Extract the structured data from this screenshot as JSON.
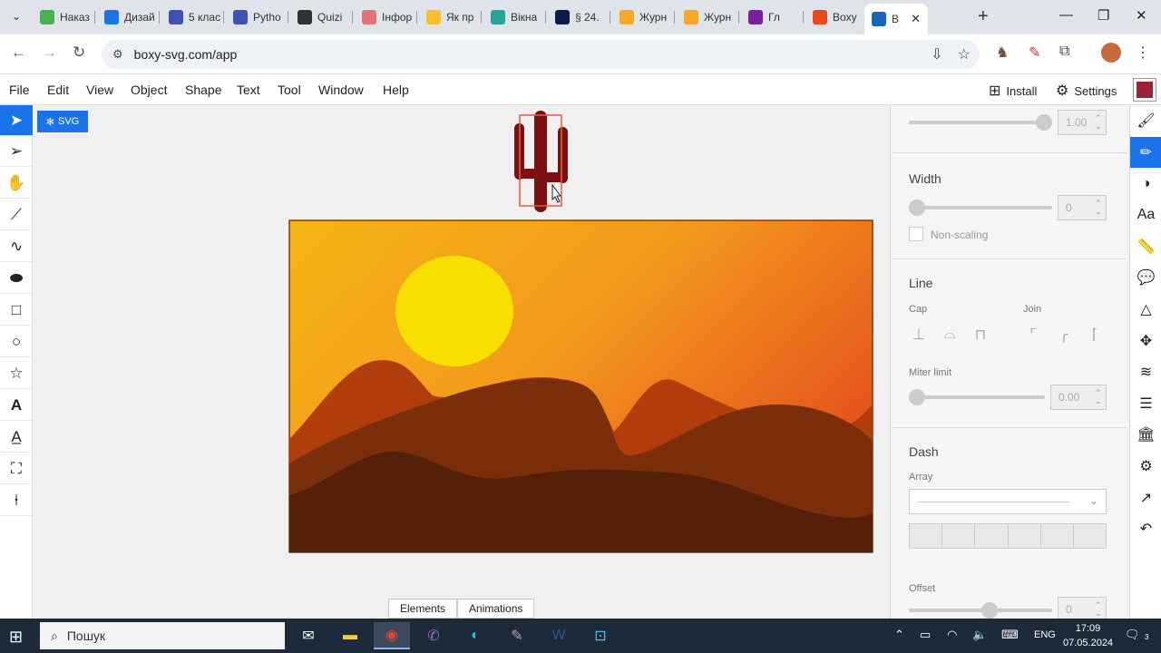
{
  "browser": {
    "tabs": [
      {
        "title": "Наказ",
        "color": "#4caf50"
      },
      {
        "title": "Дизай",
        "color": "#1a73e8"
      },
      {
        "title": "5 клас",
        "color": "#3f51b5"
      },
      {
        "title": "Pytho",
        "color": "#3f51b5"
      },
      {
        "title": "Quizi",
        "color": "#333333"
      },
      {
        "title": "Інфор",
        "color": "#e57373"
      },
      {
        "title": "Як пр",
        "color": "#fbc02d"
      },
      {
        "title": "Вікна",
        "color": "#26a69a"
      },
      {
        "title": "§ 24.",
        "color": "#0d1b4c"
      },
      {
        "title": "Журн",
        "color": "#f9a825"
      },
      {
        "title": "Журн",
        "color": "#f9a825"
      },
      {
        "title": "Гл",
        "color": "#7b1fa2"
      },
      {
        "title": "Boxy",
        "color": "#e64a19"
      },
      {
        "title": "B",
        "color": "#1565c0"
      }
    ],
    "url": "boxy-svg.com/app"
  },
  "app": {
    "menus": [
      "File",
      "Edit",
      "View",
      "Object",
      "Shape",
      "Text",
      "Tool",
      "Window",
      "Help"
    ],
    "install_label": "Install",
    "settings_label": "Settings",
    "svg_tag": "SVG",
    "bottom_tabs": [
      "Elements",
      "Animations"
    ]
  },
  "panel": {
    "opacity_value": "1.00",
    "width_title": "Width",
    "width_value": "0",
    "non_scaling_label": "Non-scaling",
    "line_title": "Line",
    "cap_label": "Cap",
    "join_label": "Join",
    "miter_label": "Miter limit",
    "miter_value": "0.00",
    "dash_title": "Dash",
    "array_label": "Array",
    "offset_label": "Offset",
    "offset_value": "0"
  },
  "taskbar": {
    "search_placeholder": "Пошук",
    "lang": "ENG",
    "time": "17:09",
    "date": "07.05.2024",
    "notifications": "3"
  }
}
